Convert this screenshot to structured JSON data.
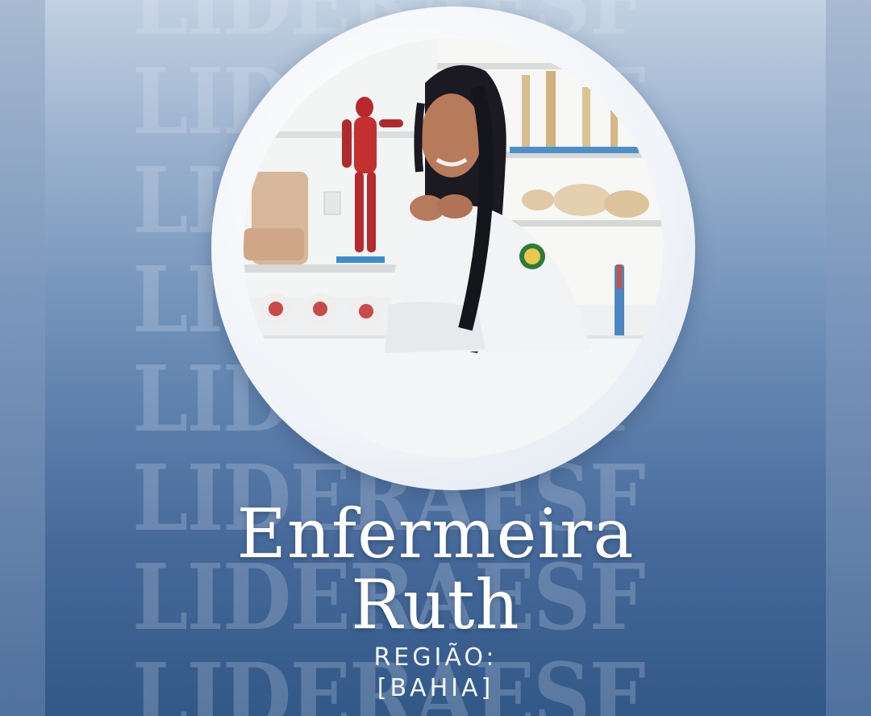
{
  "watermark": {
    "text": "LIDERAESF",
    "lines": [
      "LIDERAESF",
      "LIDERAESF",
      "LIDERAESF",
      "LIDERAESF",
      "LIDERAESF",
      "LIDERAESF",
      "LIDERAESF",
      "LIDERAESF"
    ]
  },
  "profile": {
    "title_line1": "Enfermeira",
    "title_line2": "Ruth",
    "region_label": "REGIÃO:",
    "region_value": "[BAHIA]"
  },
  "colors": {
    "background_top": "#c2d1e2",
    "background_bottom": "#325887",
    "ring": "#f1f4f8",
    "text": "#ffffff"
  },
  "icons": {
    "photo": "portrait-photo"
  }
}
